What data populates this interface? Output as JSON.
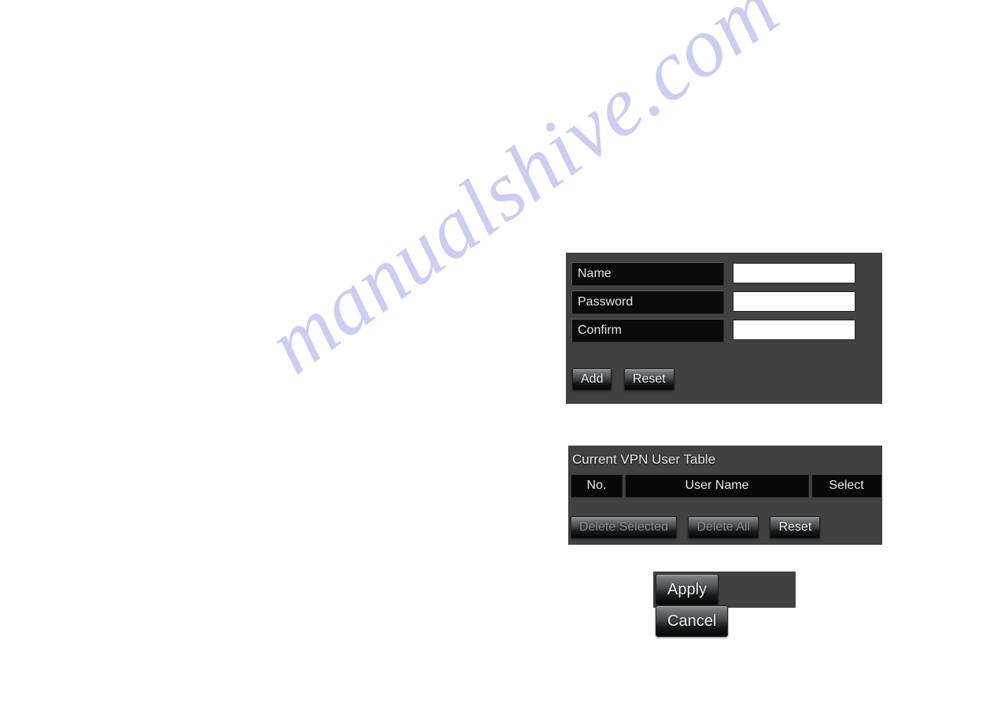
{
  "page": {
    "watermark": "manualshive.com",
    "watermark_color": "#cdcdf2",
    "background_color": "#ffffff",
    "panel_color": "#414141"
  },
  "add_user_form": {
    "fields": [
      {
        "label": "Name",
        "value": "",
        "placeholder": ""
      },
      {
        "label": "Password",
        "value": "",
        "placeholder": ""
      },
      {
        "label": "Confirm",
        "value": "",
        "placeholder": ""
      }
    ],
    "buttons": [
      {
        "label": "Add",
        "disabled": false
      },
      {
        "label": "Reset",
        "disabled": false
      }
    ]
  },
  "vpn_user_table": {
    "title": "Current VPN User Table",
    "columns": [
      "No.",
      "User Name",
      "Select"
    ],
    "rows": [],
    "buttons": [
      {
        "label": "Delete Selected",
        "disabled": true
      },
      {
        "label": "Delete All",
        "disabled": true
      },
      {
        "label": "Reset",
        "disabled": false
      }
    ]
  },
  "footer_actions": {
    "apply_label": "Apply",
    "cancel_label": "Cancel"
  }
}
